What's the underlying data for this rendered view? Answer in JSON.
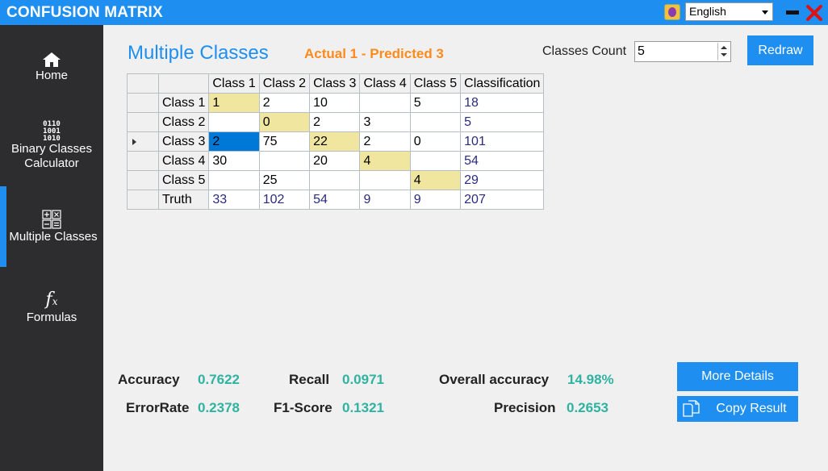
{
  "app": {
    "title": "CONFUSION MATRIX",
    "language": "English"
  },
  "sidebar": {
    "items": [
      {
        "label": "Home",
        "icon": "home-icon"
      },
      {
        "label": "Binary Classes Calculator",
        "icon": "binary-icon",
        "line1": "Binary Classes",
        "line2": "Calculator",
        "bits": [
          "0110",
          "1001",
          "1010"
        ]
      },
      {
        "label": "Multiple Classes",
        "icon": "calculator-icon",
        "active": true
      },
      {
        "label": "Formulas",
        "icon": "function-icon"
      }
    ]
  },
  "main": {
    "title": "Multiple Classes",
    "subtitle": "Actual 1 - Predicted 3",
    "classes_count_label": "Classes Count",
    "classes_count_value": "5",
    "redraw_label": "Redraw"
  },
  "grid": {
    "headers": [
      "Class 1",
      "Class 2",
      "Class 3",
      "Class 4",
      "Class 5",
      "Classification"
    ],
    "rows": [
      {
        "label": "Class 1",
        "cells": [
          "1",
          "2",
          "10",
          "",
          "5",
          "18"
        ]
      },
      {
        "label": "Class 2",
        "cells": [
          "",
          "0",
          "2",
          "3",
          "",
          "5"
        ]
      },
      {
        "label": "Class 3",
        "cells": [
          "2",
          "75",
          "22",
          "2",
          "0",
          "101"
        ]
      },
      {
        "label": "Class 4",
        "cells": [
          "30",
          "",
          "20",
          "4",
          "",
          "54"
        ]
      },
      {
        "label": "Class 5",
        "cells": [
          "",
          "25",
          "",
          "",
          "4",
          "29"
        ]
      },
      {
        "label": "Truth",
        "cells": [
          "33",
          "102",
          "54",
          "9",
          "9",
          "207"
        ]
      }
    ]
  },
  "metrics": {
    "accuracy_label": "Accuracy",
    "accuracy": "0.7622",
    "errorrate_label": "ErrorRate",
    "errorrate": "0.2378",
    "recall_label": "Recall",
    "recall": "0.0971",
    "f1_label": "F1-Score",
    "f1": "0.1321",
    "overall_label": "Overall accuracy",
    "overall": "14.98%",
    "precision_label": "Precision",
    "precision": "0.2653"
  },
  "actions": {
    "more_details": "More Details",
    "copy_result": "Copy Result"
  },
  "colors": {
    "accent": "#1e8ff0",
    "orange": "#ff8a1d",
    "teal": "#2fb3a0",
    "sidebar": "#2d2d30",
    "diagonal": "#f0e6a0",
    "selected": "#0078d7"
  }
}
